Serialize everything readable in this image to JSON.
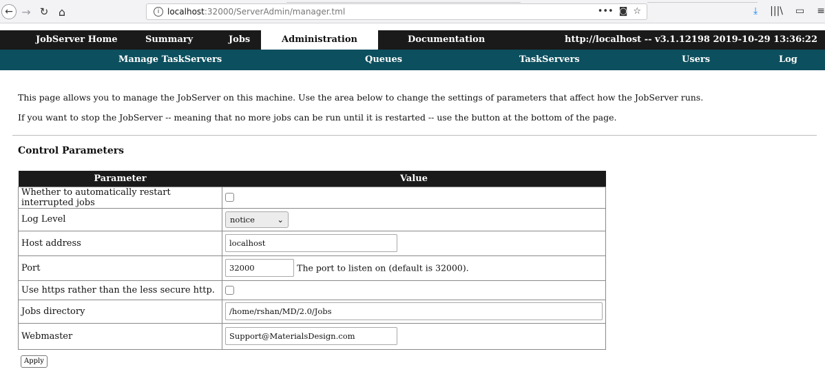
{
  "browser": {
    "url_host": "localhost",
    "url_path": ":32000/ServerAdmin/manager.tml",
    "back_icon": "←",
    "forward_icon": "→",
    "reload_icon": "↻",
    "home_icon": "⌂",
    "info_icon": "i",
    "more_icon": "•••",
    "pocket_icon": "◙",
    "bookmark_icon": "☆",
    "download_icon": "⤓",
    "library_icon": "|||\\",
    "sidebar_icon": "▭",
    "menu_icon": "≡"
  },
  "main_nav": {
    "items": [
      {
        "label": "JobServer Home"
      },
      {
        "label": "Summary"
      },
      {
        "label": "Jobs"
      },
      {
        "label": "Administration"
      },
      {
        "label": "Documentation"
      }
    ],
    "active": "Administration",
    "server_info": "http://localhost -- v3.1.12198  2019-10-29 13:36:22"
  },
  "sub_nav": {
    "items": [
      {
        "label": "Manage TaskServers"
      },
      {
        "label": "Queues"
      },
      {
        "label": "TaskServers"
      },
      {
        "label": "Users"
      },
      {
        "label": "Log"
      }
    ]
  },
  "intro": {
    "line1": "This page allows you to manage the JobServer on this machine. Use the area below to change the settings of parameters that affect how the JobServer runs.",
    "line2": "If you want to stop the JobServer -- meaning that no more jobs can be run until it is restarted -- use the button at the bottom of the page."
  },
  "section_title": "Control Parameters",
  "table": {
    "headers": [
      "Parameter",
      "Value"
    ],
    "rows": [
      {
        "label": "Whether to automatically restart interrupted jobs",
        "type": "checkbox",
        "checked": false
      },
      {
        "label": "Log Level",
        "type": "select",
        "value": "notice"
      },
      {
        "label": "Host address",
        "type": "text",
        "value": "localhost"
      },
      {
        "label": "Port",
        "type": "text",
        "value": "32000",
        "note": "The port to listen on (default is 32000)."
      },
      {
        "label": "Use https rather than the less secure http.",
        "type": "checkbox",
        "checked": false
      },
      {
        "label": "Jobs directory",
        "type": "text",
        "value": "/home/rshan/MD/2.0/Jobs"
      },
      {
        "label": "Webmaster",
        "type": "text",
        "value": "Support@MaterialsDesign.com"
      }
    ]
  },
  "apply_label": "Apply",
  "select_chevron": "⌄"
}
